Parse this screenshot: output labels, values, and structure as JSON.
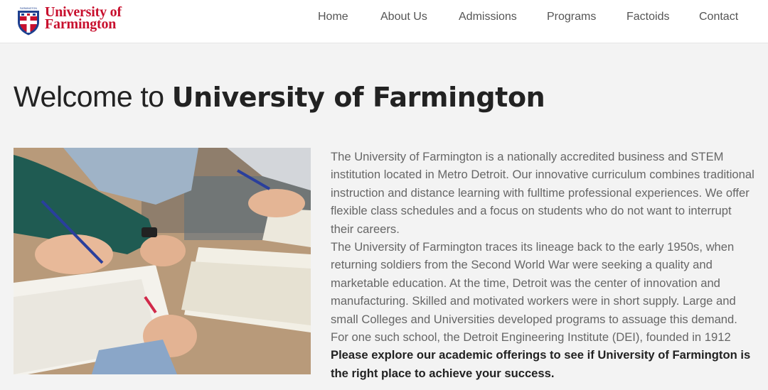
{
  "brand": {
    "logo_line1": "University of",
    "logo_line2": "Farmington",
    "shield_caption": "FARMINGTON",
    "accent_color": "#c8102e"
  },
  "nav": {
    "items": [
      {
        "label": "Home"
      },
      {
        "label": "About Us"
      },
      {
        "label": "Admissions"
      },
      {
        "label": "Programs"
      },
      {
        "label": "Factoids"
      },
      {
        "label": "Contact"
      }
    ]
  },
  "hero": {
    "title_prefix": "Welcome to ",
    "title_name": "University of Farmington"
  },
  "content": {
    "paragraph1": "The University of Farmington is a nationally accredited business and STEM institution located in Metro Detroit. Our innovative curriculum combines traditional instruction and distance learning with fulltime professional experiences. We offer flexible class schedules and a focus on students who do not want to interrupt their careers.",
    "paragraph2": "The University of Farmington traces its lineage back to the early 1950s, when returning soldiers from the Second World War were seeking a quality and marketable education. At the time, Detroit was the center of innovation and manufacturing. Skilled and motivated workers were in short supply. Large and small Colleges and Universities developed programs to assuage this demand. For one such school, the Detroit Engineering Institute (DEI), founded in 1912",
    "callout": "Please explore our academic offerings to see if University of Farmington is the right place to achieve your success."
  }
}
